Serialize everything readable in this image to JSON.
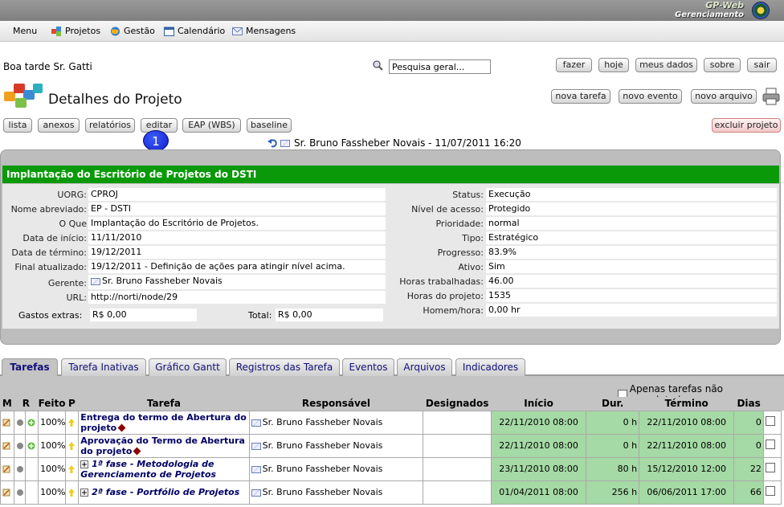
{
  "app": {
    "brand_line1": "GP-Web",
    "brand_line2": "Gerenciamento"
  },
  "menu": [
    {
      "label": "Menu",
      "icon": ""
    },
    {
      "label": "Projetos",
      "icon": "puzzle-icon"
    },
    {
      "label": "Gestão",
      "icon": "globe-icon"
    },
    {
      "label": "Calendário",
      "icon": "calendar-icon"
    },
    {
      "label": "Mensagens",
      "icon": "mail-icon"
    }
  ],
  "greeting": "Boa tarde Sr. Gatti",
  "search": {
    "value": "Pesquisa geral...",
    "placeholder": "Pesquisa geral..."
  },
  "top_buttons": {
    "fazer": "fazer",
    "hoje": "hoje",
    "meus_dados": "meus dados",
    "sobre": "sobre",
    "sair": "sair"
  },
  "page_title": "Detalhes do Projeto",
  "action_buttons": {
    "nova_tarefa": "nova tarefa",
    "novo_evento": "novo evento",
    "novo_arquivo": "novo arquivo"
  },
  "project_nav": {
    "lista": "lista",
    "anexos": "anexos",
    "relatorios": "relatórios",
    "editar": "editar",
    "eap": "EAP (WBS)",
    "baseline": "baseline",
    "excluir": "excluir projeto"
  },
  "badge_number": "1",
  "owner_line": "Sr. Bruno Fassheber Novais - 11/07/2011 16:20",
  "project": {
    "title": "Implantação do Escritório de Projetos do DSTI",
    "left": [
      {
        "label": "UORG:",
        "value": "CPROJ"
      },
      {
        "label": "Nome abreviado:",
        "value": "EP - DSTI"
      },
      {
        "label": "O Que",
        "value": "Implantação do Escritório de Projetos."
      },
      {
        "label": "Data de início:",
        "value": "11/11/2010"
      },
      {
        "label": "Data de término:",
        "value": "19/12/2011"
      },
      {
        "label": "Final atualizado:",
        "value": "19/12/2011 - Definição de ações para atingir nível acima."
      },
      {
        "label": "Gerente:",
        "value": "Sr. Bruno Fassheber Novais"
      },
      {
        "label": "URL:",
        "value": "http://norti/node/29"
      }
    ],
    "right": [
      {
        "label": "Status:",
        "value": "Execução"
      },
      {
        "label": "Nível de acesso:",
        "value": "Protegido"
      },
      {
        "label": "Prioridade:",
        "value": "normal"
      },
      {
        "label": "Tipo:",
        "value": "Estratégico"
      },
      {
        "label": "Progresso:",
        "value": "83.9%"
      },
      {
        "label": "Ativo:",
        "value": "Sim"
      },
      {
        "label": "Horas trabalhadas:",
        "value": "46.00"
      },
      {
        "label": "Horas do projeto:",
        "value": "1535"
      },
      {
        "label": "Homem/hora:",
        "value": "0,00 hr"
      }
    ],
    "gastos_label": "Gastos extras:",
    "gastos_value": "R$ 0,00",
    "total_label": "Total:",
    "total_value": "R$ 0,00"
  },
  "tabs": [
    "Tarefas",
    "Tarefa Inativas",
    "Gráfico Gantt",
    "Registros das Tarefa",
    "Eventos",
    "Arquivos",
    "Indicadores"
  ],
  "only_incomplete_label": "Apenas tarefas não completadas",
  "table": {
    "headers": {
      "m": "M",
      "r": "R",
      "feito": "Feito",
      "p": "P",
      "tarefa": "Tarefa",
      "responsavel": "Responsável",
      "designados": "Designados",
      "inicio": "Início",
      "dur": "Dur.",
      "termino": "Término",
      "dias": "Dias"
    },
    "rows": [
      {
        "feito": "100%",
        "tarefa": "Entrega do termo de Abertura do projeto",
        "responsavel": "Sr. Bruno Fassheber Novais",
        "designados": "",
        "inicio": "22/11/2010 08:00",
        "dur": "0 h",
        "termino": "22/11/2010 08:00",
        "dias": "0"
      },
      {
        "feito": "100%",
        "tarefa": "Aprovação do Termo de Abertura do projeto",
        "responsavel": "Sr. Bruno Fassheber Novais",
        "designados": "",
        "inicio": "22/11/2010 08:00",
        "dur": "0 h",
        "termino": "22/11/2010 08:00",
        "dias": "0"
      },
      {
        "feito": "100%",
        "tarefa": "1ª fase - Metodologia de Gerenciamento de Projetos",
        "responsavel": "Sr. Bruno Fassheber Novais",
        "designados": "",
        "inicio": "23/11/2010 08:00",
        "dur": "80 h",
        "termino": "15/12/2010 12:00",
        "dias": "22"
      },
      {
        "feito": "100%",
        "tarefa": "2ª fase - Portfólio de Projetos",
        "responsavel": "Sr. Bruno Fassheber Novais",
        "designados": "",
        "inicio": "01/04/2011 08:00",
        "dur": "256 h",
        "termino": "06/06/2011 17:00",
        "dias": "66"
      }
    ]
  }
}
